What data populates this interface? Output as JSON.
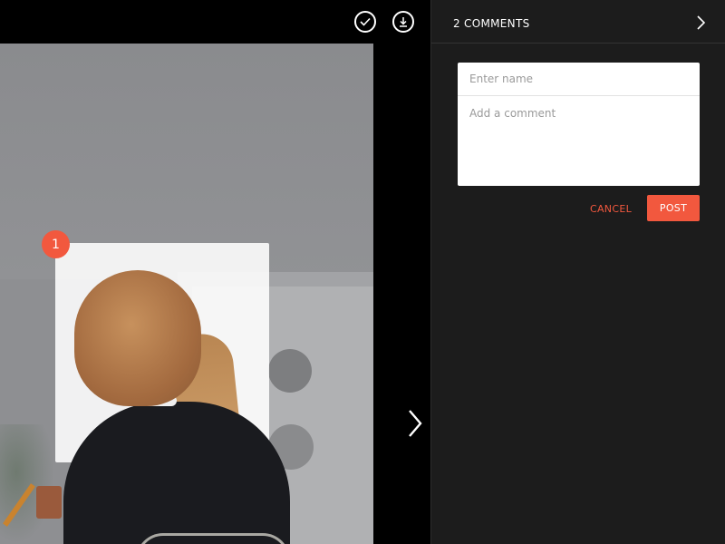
{
  "viewer": {
    "toolbar": {
      "approve_icon": "checkmark-circle-icon",
      "download_icon": "download-circle-icon"
    },
    "annotation_marker": "1",
    "next_icon": "chevron-right-icon"
  },
  "comments_panel": {
    "count_label": "2 COMMENTS",
    "close_icon": "chevron-right-icon",
    "form": {
      "name_placeholder": "Enter name",
      "comment_placeholder": "Add a comment",
      "cancel_label": "CANCEL",
      "post_label": "POST"
    }
  },
  "colors": {
    "accent": "#f2583e",
    "panel_bg": "#1c1c1c",
    "viewer_bg": "#000000"
  }
}
